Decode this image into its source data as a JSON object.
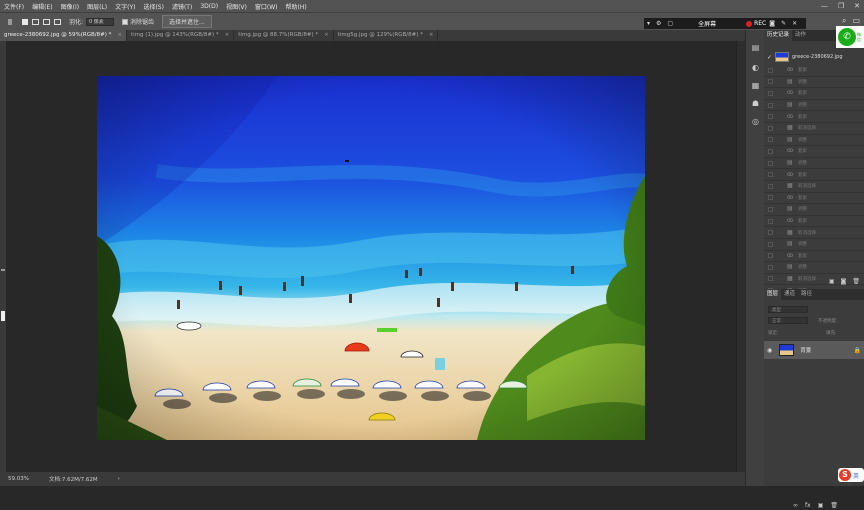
{
  "menu": [
    "文件(F)",
    "编辑(E)",
    "图像(I)",
    "图层(L)",
    "文字(Y)",
    "选择(S)",
    "滤镜(T)",
    "3D(D)",
    "视图(V)",
    "窗口(W)",
    "帮助(H)"
  ],
  "window_controls": {
    "minimize": "—",
    "restore": "❐",
    "close": "✕"
  },
  "options": {
    "feather_label": "羽化:",
    "feather_value": "0 像素",
    "antialias_label": "消除锯齿",
    "select_mask_button": "选择并遮住..."
  },
  "recorder": {
    "fullscreen_label": "全屏幕",
    "rec_label": "REC"
  },
  "tabs": [
    {
      "label": "greece-2380692.jpg @ 59%(RGB/8#) *",
      "active": true
    },
    {
      "label": "timg (1).jpg @ 143%(RGB/8#) *",
      "active": false
    },
    {
      "label": "timg.jpg @ 88.7%(RGB/8#) *",
      "active": false
    },
    {
      "label": "timg5g.jpg @ 129%(RGB/8#) *",
      "active": false
    }
  ],
  "status": {
    "zoom": "59.03%",
    "doc": "文档:7.62M/7.62M",
    "arrow": "›"
  },
  "history": {
    "tabs": [
      "历史记录",
      "动作"
    ],
    "snapshot": "greece-2380692.jpg",
    "steps": [
      "套索",
      "调整",
      "套索",
      "调整",
      "套索",
      "取消选择",
      "调整",
      "套索",
      "调整",
      "套索",
      "取消选择",
      "套索",
      "调整",
      "套索",
      "取消选择",
      "调整",
      "套索",
      "调整",
      "取消选择",
      "调整"
    ]
  },
  "layers": {
    "tabs": [
      "图层",
      "通道",
      "路径"
    ],
    "filter_label": "类型",
    "blend_mode": "正常",
    "opacity_label": "不透明度:",
    "fill_label": "填充:",
    "lock_label": "锁定:",
    "layer_name": "背景"
  },
  "overlay": {
    "wechat_text_top": "微",
    "wechat_text_bottom": "信",
    "sogou_label": "英"
  },
  "colors": {
    "accent": "#1aad19",
    "rec_dot": "#e02020",
    "ui_bg": "#535353"
  }
}
